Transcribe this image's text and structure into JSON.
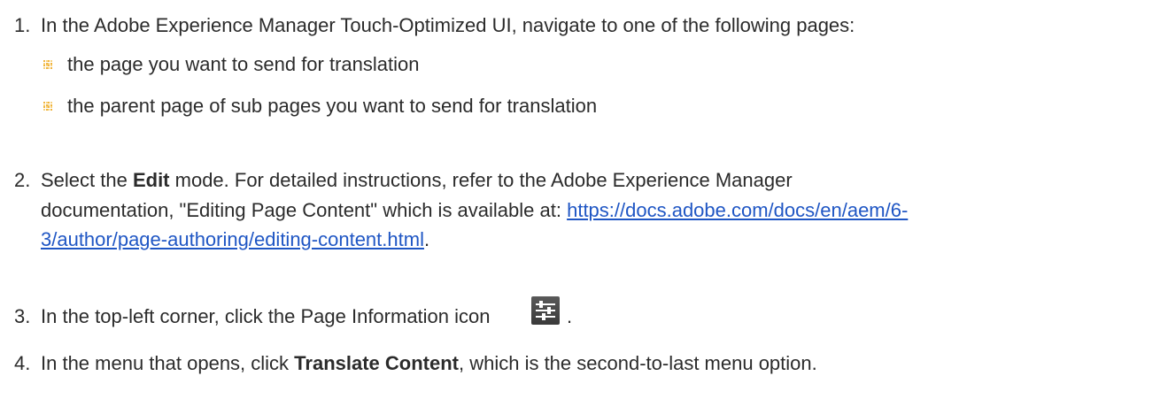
{
  "steps": [
    {
      "number": "1.",
      "text": "In the Adobe Experience Manager Touch-Optimized UI, navigate to one of the following pages:",
      "bullets": [
        "the page you want to send for translation",
        "the parent page of sub pages you want to send for translation"
      ]
    },
    {
      "number": "2.",
      "before_bold": "Select the ",
      "bold": "Edit",
      "after_bold_line1": " mode. For detailed instructions, refer to the Adobe Experience Manager",
      "line2_prefix": "documentation, \"Editing Page Content\" which is available at: ",
      "link_part1": "https://docs.adobe.com/docs/en/aem/6-",
      "link_part2": "3/author/page-authoring/editing-content.html",
      "line3_suffix": "."
    },
    {
      "number": "3.",
      "text": "In the top-left corner, click the Page Information icon",
      "after_icon": ".",
      "icon": "page-information-icon"
    },
    {
      "number": "4.",
      "before_bold": "In the menu that opens, click ",
      "bold": "Translate Content",
      "after_bold": ", which is the second-to-last menu option."
    }
  ],
  "colors": {
    "text": "#2b2b2b",
    "link": "#1f56c4",
    "bullet": "#f0b33c"
  }
}
